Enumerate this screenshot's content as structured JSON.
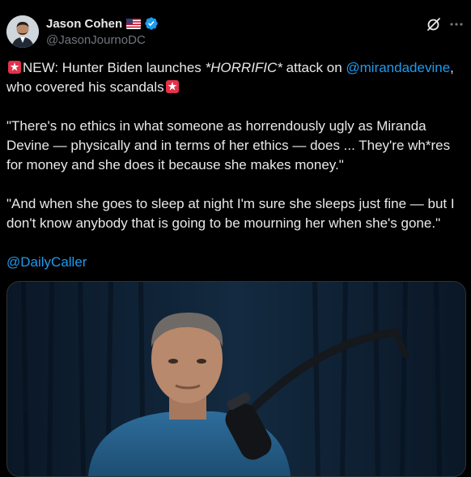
{
  "author": {
    "display_name": "Jason Cohen",
    "handle": "@JasonJournoDC",
    "flag_icon": "us-flag-icon",
    "verified_icon": "verified-badge-icon"
  },
  "actions": {
    "grok_icon": "grok-icon",
    "more_icon": "more-horizontal-icon"
  },
  "tweet": {
    "line1": {
      "prefix": "NEW: Hunter Biden launches ",
      "emphasis": "*HORRIFIC*",
      "middle": " attack on ",
      "mention": "@mirandadevine",
      "suffix": ", who covered his scandals"
    },
    "quote1": "\"There's no ethics in what someone as horrendously ugly as Miranda Devine — physically and in terms of her ethics — does ... They're wh*res for money and she does it because she makes money.\"",
    "quote2": "\"And when she goes to sleep at night I'm sure she sleeps just fine — but I don't know anybody that is going to be mourning her when she's gone.\"",
    "source_mention": "@DailyCaller"
  },
  "media": {
    "kind": "video-thumbnail",
    "icon": "podcast-microphone-photo"
  },
  "colors": {
    "background": "#000000",
    "text": "#e7e9ea",
    "secondary": "#71767b",
    "link": "#1d9bf0",
    "verified": "#1d9bf0",
    "siren": "#e0334a"
  }
}
